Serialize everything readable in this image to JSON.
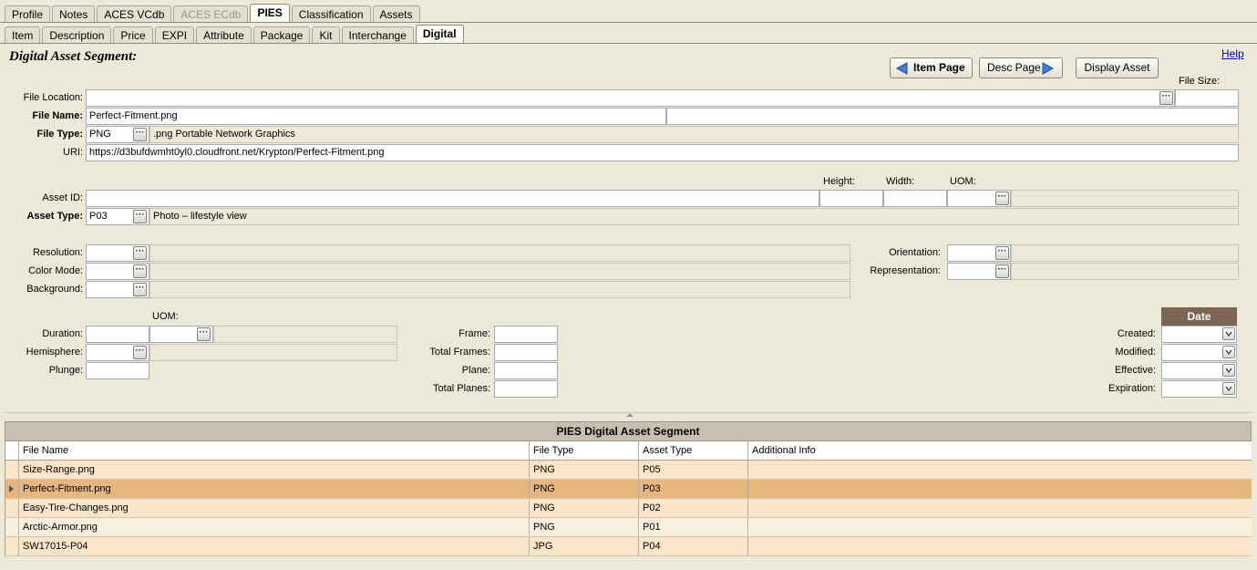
{
  "top_tabs": [
    {
      "label": "Profile",
      "active": false,
      "disabled": false
    },
    {
      "label": "Notes",
      "active": false,
      "disabled": false
    },
    {
      "label": "ACES VCdb",
      "active": false,
      "disabled": false
    },
    {
      "label": "ACES ECdb",
      "active": false,
      "disabled": true
    },
    {
      "label": "PIES",
      "active": true,
      "disabled": false
    },
    {
      "label": "Classification",
      "active": false,
      "disabled": false
    },
    {
      "label": "Assets",
      "active": false,
      "disabled": false
    }
  ],
  "sub_tabs": [
    {
      "label": "Item",
      "active": false
    },
    {
      "label": "Description",
      "active": false
    },
    {
      "label": "Price",
      "active": false
    },
    {
      "label": "EXPI",
      "active": false
    },
    {
      "label": "Attribute",
      "active": false
    },
    {
      "label": "Package",
      "active": false
    },
    {
      "label": "Kit",
      "active": false
    },
    {
      "label": "Interchange",
      "active": false
    },
    {
      "label": "Digital",
      "active": true
    }
  ],
  "segment_title": "Digital Asset Segment:",
  "help_link": "Help",
  "buttons": {
    "item_page": "Item Page",
    "desc_page": "Desc Page",
    "display_asset": "Display Asset"
  },
  "labels": {
    "file_size": "File Size:",
    "file_location": "File Location:",
    "file_name": "File Name:",
    "file_type": "File Type:",
    "uri": "URI:",
    "height": "Height:",
    "width": "Width:",
    "uom": "UOM:",
    "asset_id": "Asset ID:",
    "asset_type": "Asset Type:",
    "resolution": "Resolution:",
    "color_mode": "Color Mode:",
    "background": "Background:",
    "orientation": "Orientation:",
    "representation": "Representation:",
    "duration_uom": "UOM:",
    "duration": "Duration:",
    "hemisphere": "Hemisphere:",
    "plunge": "Plunge:",
    "frame": "Frame:",
    "total_frames": "Total Frames:",
    "plane": "Plane:",
    "total_planes": "Total Planes:",
    "date_header": "Date",
    "created": "Created:",
    "modified": "Modified:",
    "effective": "Effective:",
    "expiration": "Expiration:"
  },
  "fields": {
    "file_location": "",
    "file_size": "",
    "file_name": "Perfect-Fitment.png",
    "file_name_extra": "",
    "file_type_code": "PNG",
    "file_type_desc": ".png Portable Network Graphics",
    "uri": "https://d3bufdwmht0yl0.cloudfront.net/Krypton/Perfect-Fitment.png",
    "asset_id": "",
    "height": "",
    "width": "",
    "uom": "",
    "uom_desc": "",
    "asset_type_code": "P03",
    "asset_type_desc": "Photo – lifestyle view",
    "resolution": "",
    "color_mode": "",
    "background": "",
    "orientation": "",
    "representation": "",
    "duration": "",
    "duration_uom": "",
    "hemisphere": "",
    "plunge": "",
    "frame": "",
    "total_frames": "",
    "plane": "",
    "total_planes": "",
    "created": "",
    "modified": "",
    "effective": "",
    "expiration": ""
  },
  "grid": {
    "title": "PIES Digital Asset Segment",
    "columns": [
      "File Name",
      "File Type",
      "Asset Type",
      "Additional Info"
    ],
    "rows": [
      {
        "file_name": "Size-Range.png",
        "file_type": "PNG",
        "asset_type": "P05",
        "info": "",
        "selected": false
      },
      {
        "file_name": "Perfect-Fitment.png",
        "file_type": "PNG",
        "asset_type": "P03",
        "info": "",
        "selected": true
      },
      {
        "file_name": "Easy-Tire-Changes.png",
        "file_type": "PNG",
        "asset_type": "P02",
        "info": "",
        "selected": false
      },
      {
        "file_name": "Arctic-Armor.png",
        "file_type": "PNG",
        "asset_type": "P01",
        "info": "",
        "selected": false
      },
      {
        "file_name": "SW17015-P04",
        "file_type": "JPG",
        "asset_type": "P04",
        "info": "",
        "selected": false
      }
    ]
  },
  "colors": {
    "background": "#ece9d8",
    "selected_row": "#e6b67e",
    "row_alt": "#fbe5c8",
    "date_header": "#7d6556",
    "arrow_blue": "#3b7fd6"
  }
}
